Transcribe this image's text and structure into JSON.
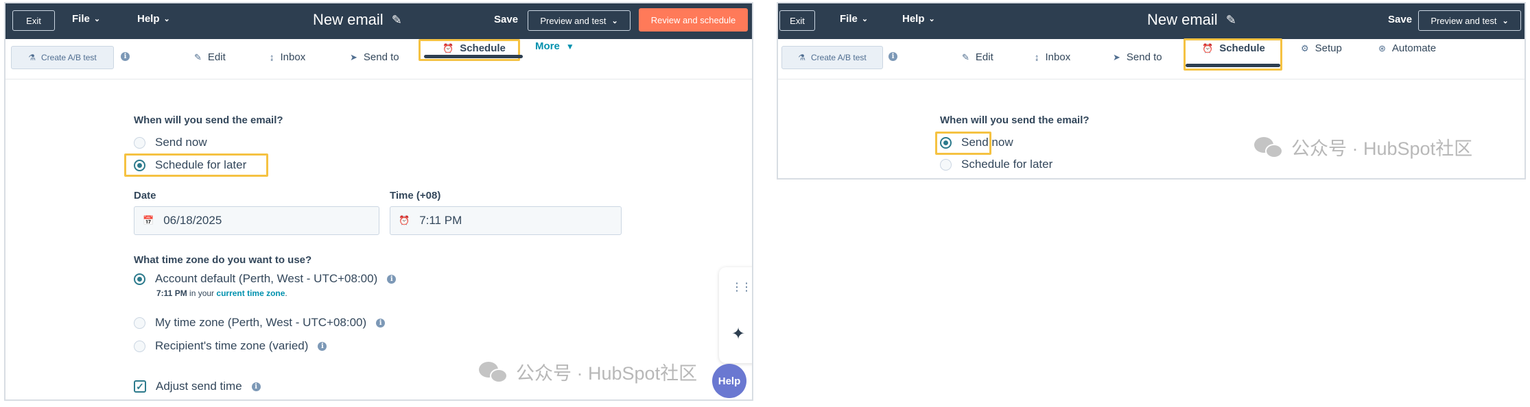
{
  "left": {
    "topbar": {
      "exit": "Exit",
      "file": "File",
      "help": "Help",
      "title": "New email",
      "save": "Save",
      "preview": "Preview and test",
      "review": "Review and schedule"
    },
    "subbar": {
      "ab_test": "Create A/B test",
      "tabs": {
        "edit": "Edit",
        "inbox": "Inbox",
        "send_to": "Send to",
        "schedule": "Schedule",
        "more": "More"
      }
    },
    "form": {
      "question": "When will you send the email?",
      "send_now": "Send now",
      "schedule_later": "Schedule for later",
      "date_label": "Date",
      "date_value": "06/18/2025",
      "time_label": "Time (+08)",
      "time_value": "7:11 PM",
      "tz_question": "What time zone do you want to use?",
      "tz_account": "Account default (Perth, West - UTC+08:00)",
      "tz_note_time": "7:11 PM",
      "tz_note_mid": " in your ",
      "tz_note_link": "current time zone",
      "tz_note_end": ".",
      "tz_mine": "My time zone (Perth, West - UTC+08:00)",
      "tz_recipient": "Recipient's time zone (varied)",
      "adjust": "Adjust send time"
    },
    "help_button": "Help",
    "watermark": "公众号 · HubSpot社区"
  },
  "right": {
    "topbar": {
      "exit": "Exit",
      "file": "File",
      "help": "Help",
      "title": "New email",
      "save": "Save",
      "preview": "Preview and test"
    },
    "subbar": {
      "ab_test": "Create A/B test",
      "tabs": {
        "edit": "Edit",
        "inbox": "Inbox",
        "send_to": "Send to",
        "schedule": "Schedule",
        "setup": "Setup",
        "automate": "Automate"
      }
    },
    "form": {
      "question": "When will you send the email?",
      "send_now": "Send now",
      "schedule_later": "Schedule for later"
    },
    "watermark": "公众号 · HubSpot社区"
  },
  "colors": {
    "topbar": "#2d3e50",
    "accent_orange": "#ff7a59",
    "highlight": "#f5c242",
    "radio_selected": "#2c7a8c",
    "link": "#0091ae",
    "help_button": "#6a78d1"
  }
}
